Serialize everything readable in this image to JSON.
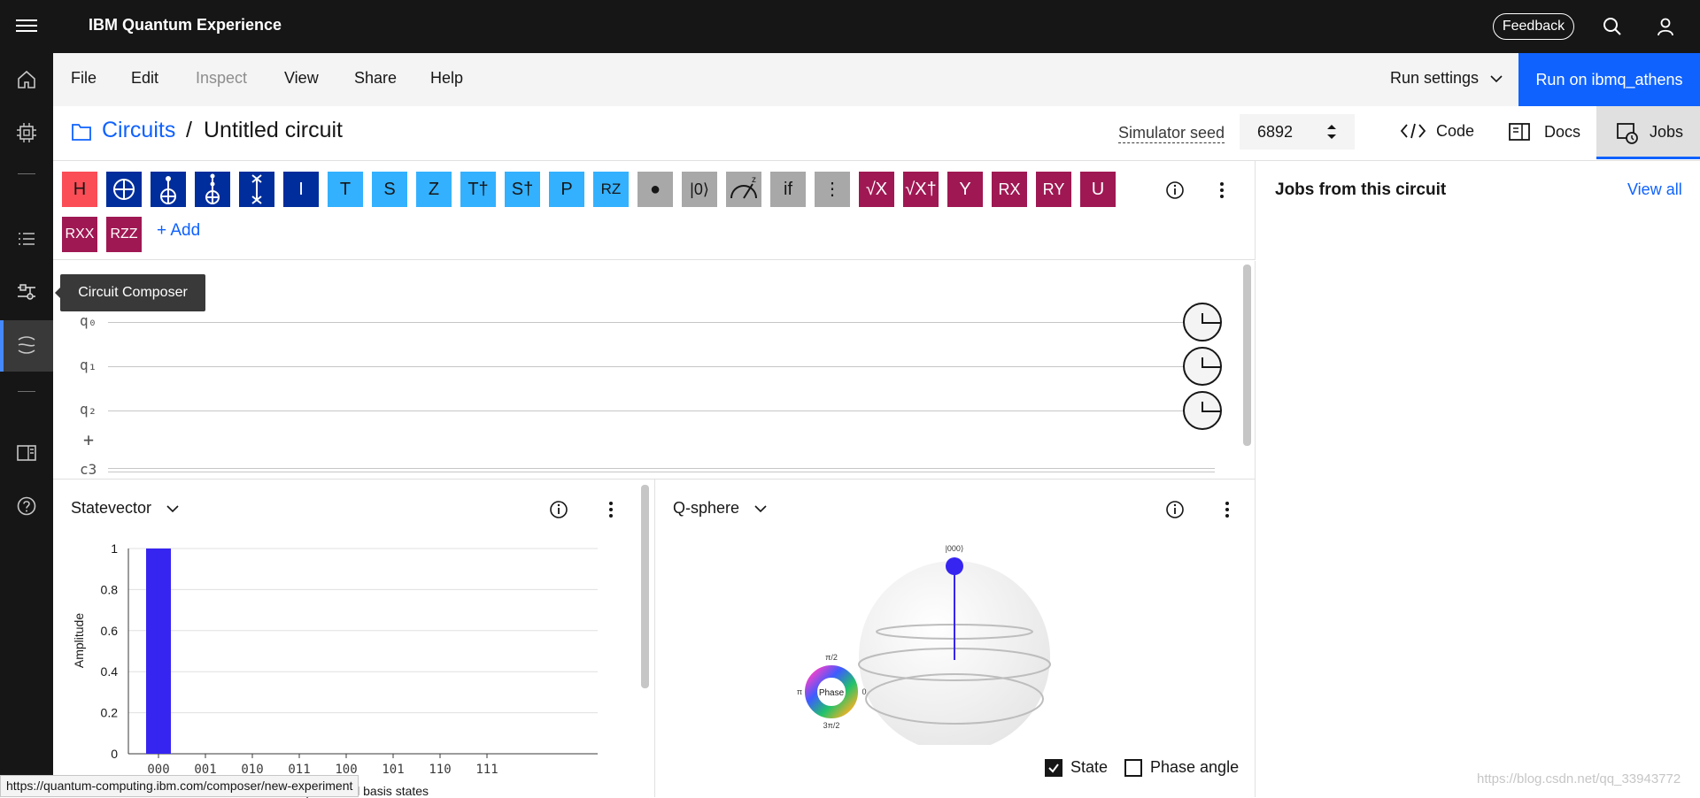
{
  "app": {
    "title": "IBM Quantum Experience",
    "feedback_label": "Feedback"
  },
  "tooltip": "Circuit Composer",
  "menu": {
    "items": [
      "File",
      "Edit",
      "Inspect",
      "View",
      "Share",
      "Help"
    ],
    "run_settings": "Run settings",
    "run_button": "Run on ibmq_athens"
  },
  "breadcrumb": {
    "parent": "Circuits",
    "separator": "/",
    "current": "Untitled circuit"
  },
  "seed": {
    "label": "Simulator seed",
    "value": "6892"
  },
  "header_buttons": {
    "code": "Code",
    "docs": "Docs",
    "jobs": "Jobs"
  },
  "gates": {
    "row1": [
      "H",
      "CX",
      "CCX",
      "CCX2",
      "SWAP",
      "I",
      "T",
      "S",
      "Z",
      "T†",
      "S†",
      "P",
      "RZ",
      "●",
      "|0⟩",
      "measure",
      "if",
      "⋮",
      "√X",
      "√X†",
      "Y",
      "RX",
      "RY",
      "U"
    ],
    "row2": [
      "RXX",
      "RZZ"
    ],
    "add": "+ Add"
  },
  "circuit": {
    "qubits": [
      "q₀",
      "q₁",
      "q₂"
    ],
    "plus": "+",
    "classical": "c3"
  },
  "statevector": {
    "title": "Statevector",
    "ylabel": "Amplitude",
    "xlabel": "Computational basis states",
    "yticks": [
      "1",
      "0.8",
      "0.6",
      "0.4",
      "0.2",
      "0"
    ],
    "xticks": [
      "000",
      "001",
      "010",
      "011",
      "100",
      "101",
      "110",
      "111"
    ]
  },
  "chart_data": {
    "type": "bar",
    "categories": [
      "000",
      "001",
      "010",
      "011",
      "100",
      "101",
      "110",
      "111"
    ],
    "values": [
      1,
      0,
      0,
      0,
      0,
      0,
      0,
      0
    ],
    "xlabel": "Computational basis states",
    "ylabel": "Amplitude",
    "ylim": [
      0,
      1
    ],
    "bar_color": "#3625f1"
  },
  "qsphere": {
    "title": "Q-sphere",
    "state_label": "|000⟩",
    "phase_center": "Phase",
    "phase_labels": {
      "top": "π/2",
      "right": "0",
      "bottom": "3π/2",
      "left": "π"
    },
    "state_checkbox": "State",
    "phase_checkbox": "Phase angle"
  },
  "jobs_panel": {
    "title": "Jobs from this circuit",
    "view_all": "View all"
  },
  "status_url": "https://quantum-computing.ibm.com/composer/new-experiment",
  "watermark": "https://blog.csdn.net/qq_33943772",
  "colors": {
    "accent": "#0f62fe",
    "navy_gate": "#002d9c",
    "cyan_gate": "#33b1ff",
    "magenta_gate": "#9f1853",
    "red_gate": "#fa4d56",
    "grey_gate": "#a8a8a8"
  }
}
